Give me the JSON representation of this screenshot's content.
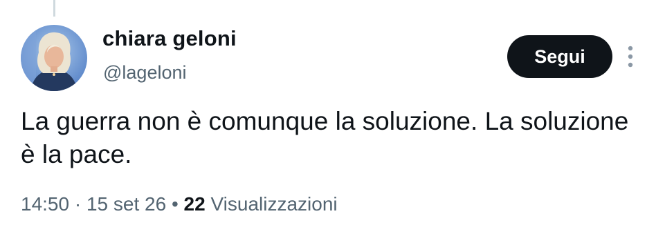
{
  "tweet": {
    "author": {
      "display_name": "chiara geloni",
      "handle": "@lageloni"
    },
    "follow_label": "Segui",
    "text": "La guerra non è comunque la soluzione. La soluzione è la pace.",
    "time": "14:50",
    "separator": "·",
    "date": "15 set 26",
    "dot": "•",
    "views_count": "22",
    "views_label": "Visualizzazioni"
  },
  "icons": {
    "more": "more-vertical-icon"
  },
  "colors": {
    "text_primary": "#0f1419",
    "text_secondary": "#536471",
    "button_bg": "#0f1419",
    "thread_line": "#cfd9de"
  }
}
